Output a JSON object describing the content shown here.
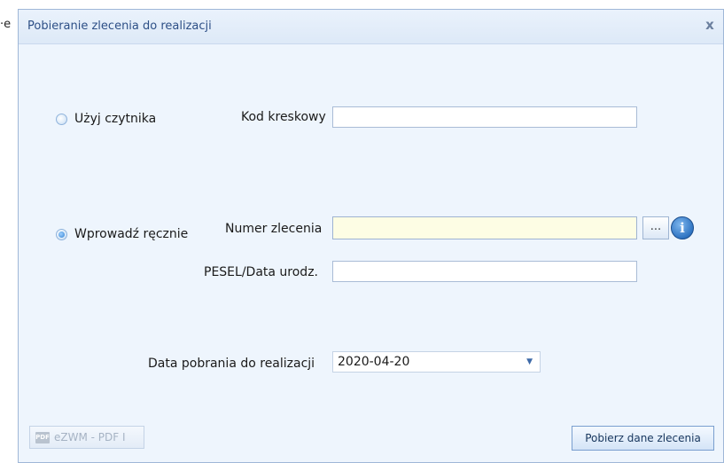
{
  "background_edge_text": "·e",
  "dialog": {
    "title": "Pobieranie zlecenia do realizacji",
    "close_label": "x"
  },
  "scanner_option": {
    "label": "Użyj czytnika",
    "checked": false,
    "barcode_label": "Kod kreskowy",
    "barcode_value": ""
  },
  "manual_option": {
    "label": "Wprowadź ręcznie",
    "checked": true,
    "order_number_label": "Numer zlecenia",
    "order_number_value": "",
    "browse_button_label": "...",
    "info_icon": "i",
    "pesel_label": "PESEL/Data urodz.",
    "pesel_value": ""
  },
  "download_date": {
    "label": "Data pobrania do realizacji",
    "value": "2020-04-20"
  },
  "footer": {
    "pdf_button_label": "eZWM - PDF I",
    "pdf_icon_text": "PDF",
    "fetch_button_label": "Pobierz dane zlecenia"
  }
}
